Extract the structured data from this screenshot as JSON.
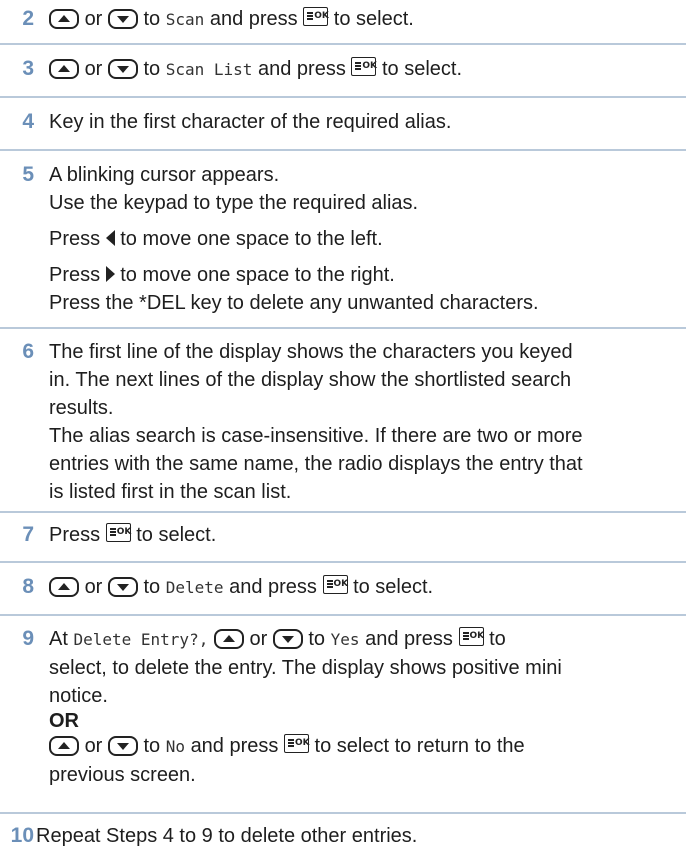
{
  "steps": [
    {
      "number": "2",
      "a": "or",
      "b": "to",
      "menu": "Scan",
      "c": "and press",
      "d": "to select."
    },
    {
      "number": "3",
      "a": "or",
      "b": "to",
      "menu": "Scan List",
      "c": "and press",
      "d": "to select."
    },
    {
      "number": "4",
      "text": "Key in the first character of the required alias."
    },
    {
      "number": "5",
      "l1": "A blinking cursor appears.",
      "l2": "Use the keypad to type the required alias.",
      "l3a": "Press",
      "l3b": "to move one space to the left.",
      "l4a": "Press",
      "l4b": "to move one space to the right.",
      "l5": "Press the *DEL key to delete any unwanted characters."
    },
    {
      "number": "6",
      "l1": "The first line of the display shows the characters you keyed",
      "l2": "in. The next lines of the display show the shortlisted search",
      "l3": "results.",
      "l4": "The alias search is case-insensitive. If there are two or more",
      "l5": "entries with the same name, the radio displays the entry that",
      "l6": "is listed first in the scan list."
    },
    {
      "number": "7",
      "a": "Press",
      "b": "to select."
    },
    {
      "number": "8",
      "a": "or",
      "b": "to",
      "menu": "Delete",
      "c": "and press",
      "d": "to select."
    },
    {
      "number": "9",
      "l1a": "At",
      "l1prompt": "Delete Entry?,",
      "l1b": "or",
      "l1c": "to",
      "l1menu": "Yes",
      "l1d": "and press",
      "l1e": "to",
      "l2": "select, to delete the entry. The display shows positive mini",
      "l3": "notice.",
      "or": "OR",
      "l5a": "or",
      "l5b": "to",
      "l5menu": "No",
      "l5c": "and press",
      "l5d": "to select to return to the",
      "l6": "previous screen."
    },
    {
      "number": "10",
      "text": "Repeat Steps 4 to 9 to delete other entries."
    }
  ],
  "icons": {
    "up": "up-arrow-key-icon",
    "down": "down-arrow-key-icon",
    "ok": "menu-ok-key-icon",
    "left": "left-arrow-icon",
    "right": "right-arrow-icon"
  },
  "ok_key_label": "OK",
  "colors": {
    "step_number": "#6b8fb8",
    "rule": "#b9c9da",
    "text": "#1e1e1e"
  }
}
